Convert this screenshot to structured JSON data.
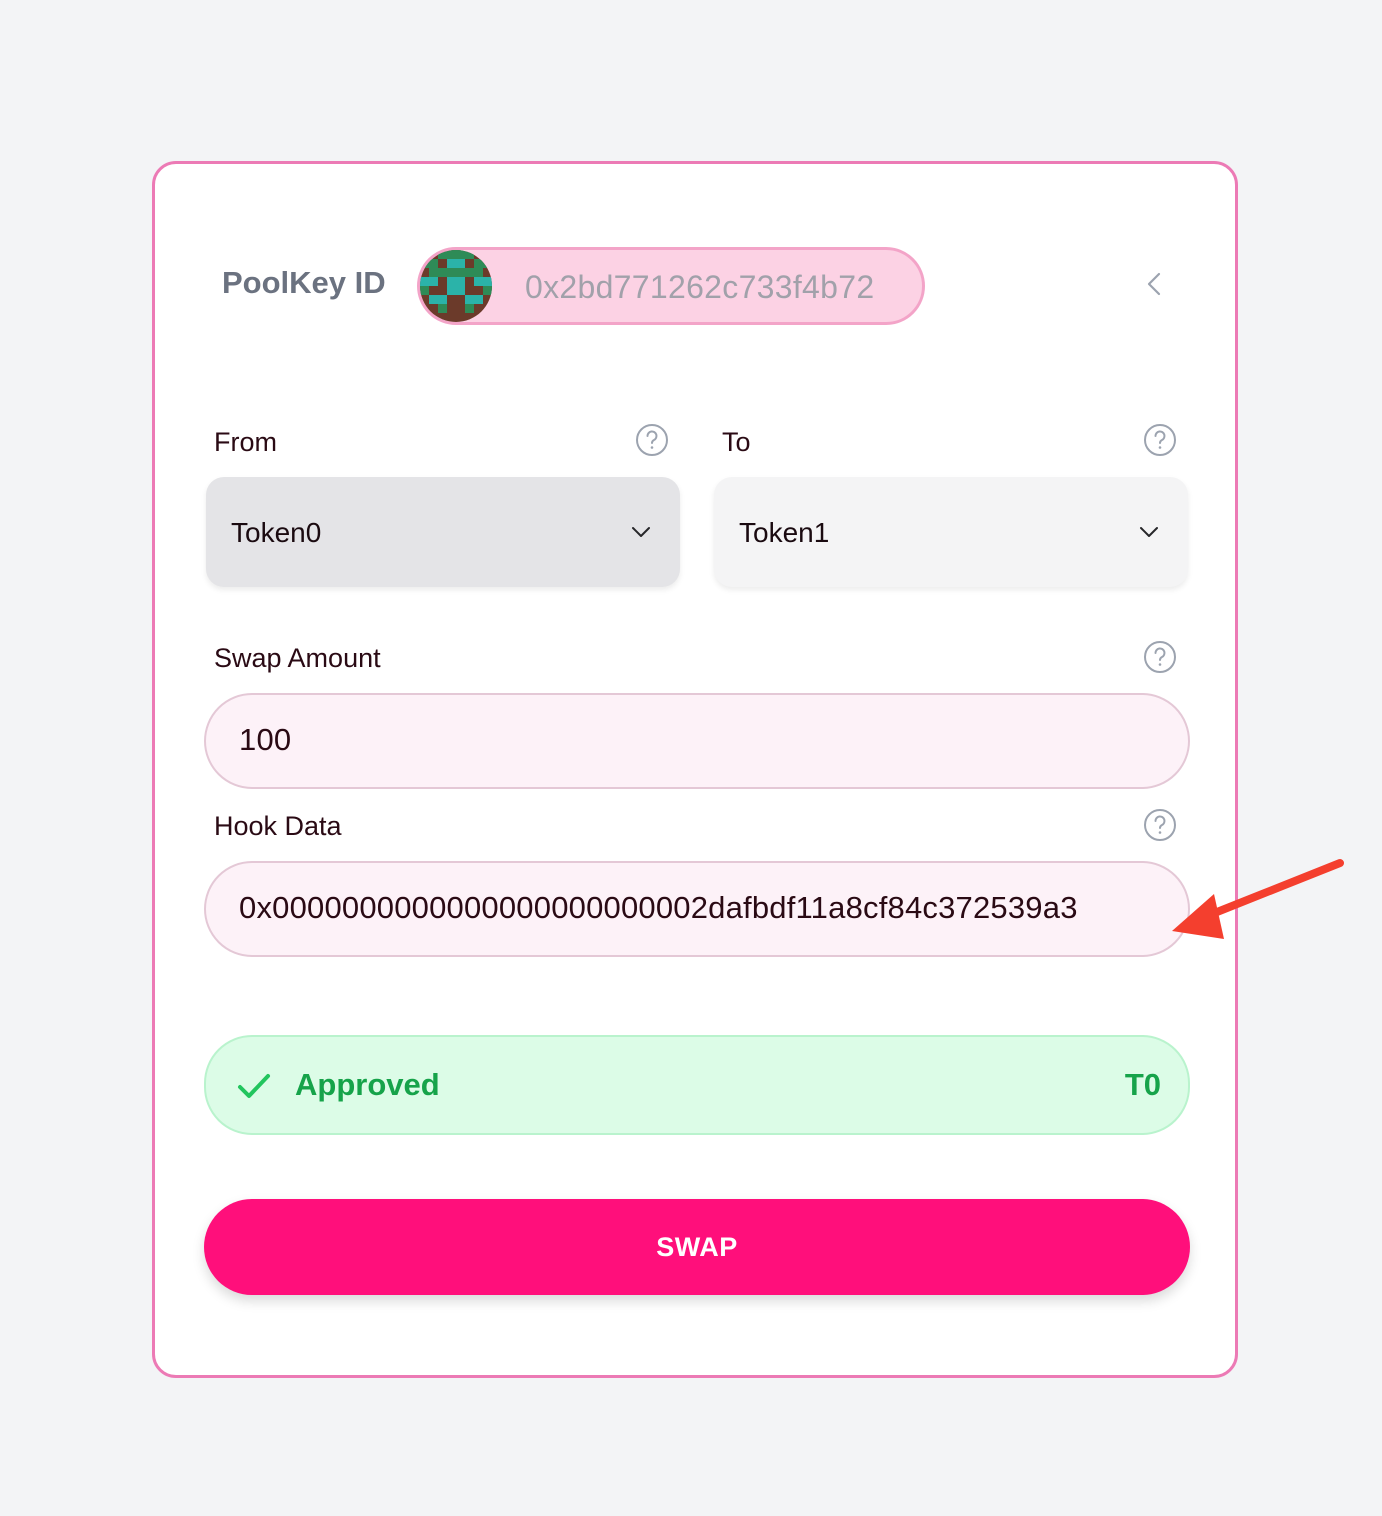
{
  "poolkey": {
    "label": "PoolKey ID",
    "value": "0x2bd771262c733f4b72",
    "avatar_icon": "identicon-avatar",
    "collapse_icon": "chevron-left-icon"
  },
  "from": {
    "label": "From",
    "selected": "Token0",
    "help_icon": "help-circle-icon",
    "chevron_icon": "chevron-down-icon"
  },
  "to": {
    "label": "To",
    "selected": "Token1",
    "help_icon": "help-circle-icon",
    "chevron_icon": "chevron-down-icon"
  },
  "swap_amount": {
    "label": "Swap Amount",
    "value": "100",
    "help_icon": "help-circle-icon"
  },
  "hook_data": {
    "label": "Hook Data",
    "value": "0x0000000000000000000000002dafbdf11a8cf84c372539a3",
    "help_icon": "help-circle-icon"
  },
  "approval": {
    "status": "Approved",
    "token": "T0",
    "check_icon": "check-icon"
  },
  "swap_button": {
    "label": "SWAP"
  },
  "annotation": {
    "arrow_icon": "red-arrow-icon"
  },
  "colors": {
    "page_bg": "#f3f4f6",
    "card_border": "#ec7ab5",
    "accent": "#ff0f7b",
    "approved_bg": "#dcfce7",
    "approved_text": "#16a34a",
    "from_select_bg": "#e4e4e7",
    "to_select_bg": "#f4f4f5",
    "input_bg": "#fdf2f8"
  }
}
